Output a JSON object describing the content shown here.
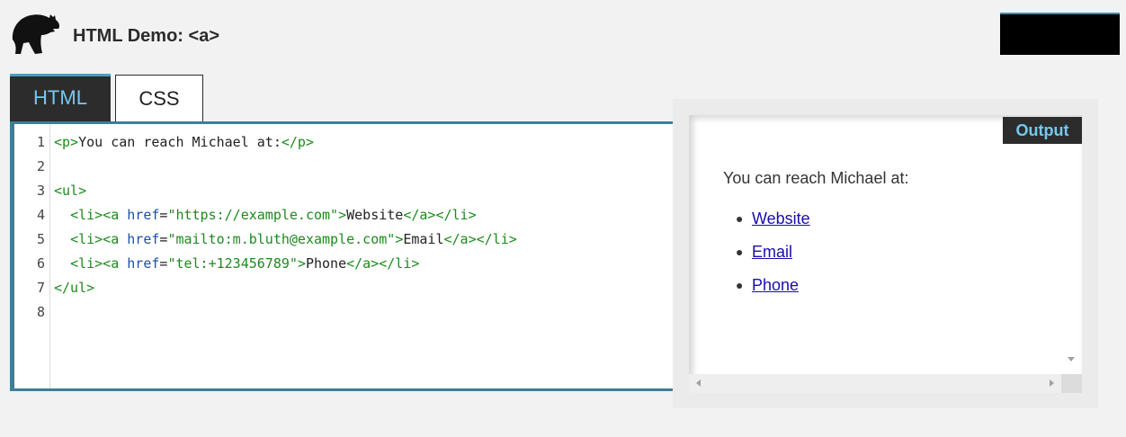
{
  "header": {
    "title": "HTML Demo: <a>"
  },
  "tabs": [
    {
      "label": "HTML",
      "active": true
    },
    {
      "label": "CSS",
      "active": false
    }
  ],
  "editor": {
    "line_numbers": [
      "1",
      "2",
      "3",
      "4",
      "5",
      "6",
      "7",
      "8"
    ],
    "lines": [
      [
        {
          "t": "tag",
          "v": "<p>"
        },
        {
          "t": "txt",
          "v": "You can reach Michael at:"
        },
        {
          "t": "tag",
          "v": "</p>"
        }
      ],
      [],
      [
        {
          "t": "tag",
          "v": "<ul>"
        }
      ],
      [
        {
          "t": "txt",
          "v": "  "
        },
        {
          "t": "tag",
          "v": "<li><a "
        },
        {
          "t": "attr",
          "v": "href"
        },
        {
          "t": "txt",
          "v": "="
        },
        {
          "t": "str",
          "v": "\"https://example.com\""
        },
        {
          "t": "tag",
          "v": ">"
        },
        {
          "t": "txt",
          "v": "Website"
        },
        {
          "t": "tag",
          "v": "</a></li>"
        }
      ],
      [
        {
          "t": "txt",
          "v": "  "
        },
        {
          "t": "tag",
          "v": "<li><a "
        },
        {
          "t": "attr",
          "v": "href"
        },
        {
          "t": "txt",
          "v": "="
        },
        {
          "t": "str",
          "v": "\"mailto:m.bluth@example.com\""
        },
        {
          "t": "tag",
          "v": ">"
        },
        {
          "t": "txt",
          "v": "Email"
        },
        {
          "t": "tag",
          "v": "</a></li>"
        }
      ],
      [
        {
          "t": "txt",
          "v": "  "
        },
        {
          "t": "tag",
          "v": "<li><a "
        },
        {
          "t": "attr",
          "v": "href"
        },
        {
          "t": "txt",
          "v": "="
        },
        {
          "t": "str",
          "v": "\"tel:+123456789\""
        },
        {
          "t": "tag",
          "v": ">"
        },
        {
          "t": "txt",
          "v": "Phone"
        },
        {
          "t": "tag",
          "v": "</a></li>"
        }
      ],
      [
        {
          "t": "tag",
          "v": "</ul>"
        }
      ],
      []
    ]
  },
  "output": {
    "label": "Output",
    "paragraph": "You can reach Michael at:",
    "links": [
      "Website",
      "Email",
      "Phone"
    ]
  },
  "colors": {
    "accent": "#3c7f99",
    "tab_active_text": "#76c8ee",
    "tag": "#1c8a1c",
    "attr": "#1d4fa3",
    "link": "#1a0dab"
  },
  "icons": {
    "logo": "dinosaur-head-logo"
  }
}
